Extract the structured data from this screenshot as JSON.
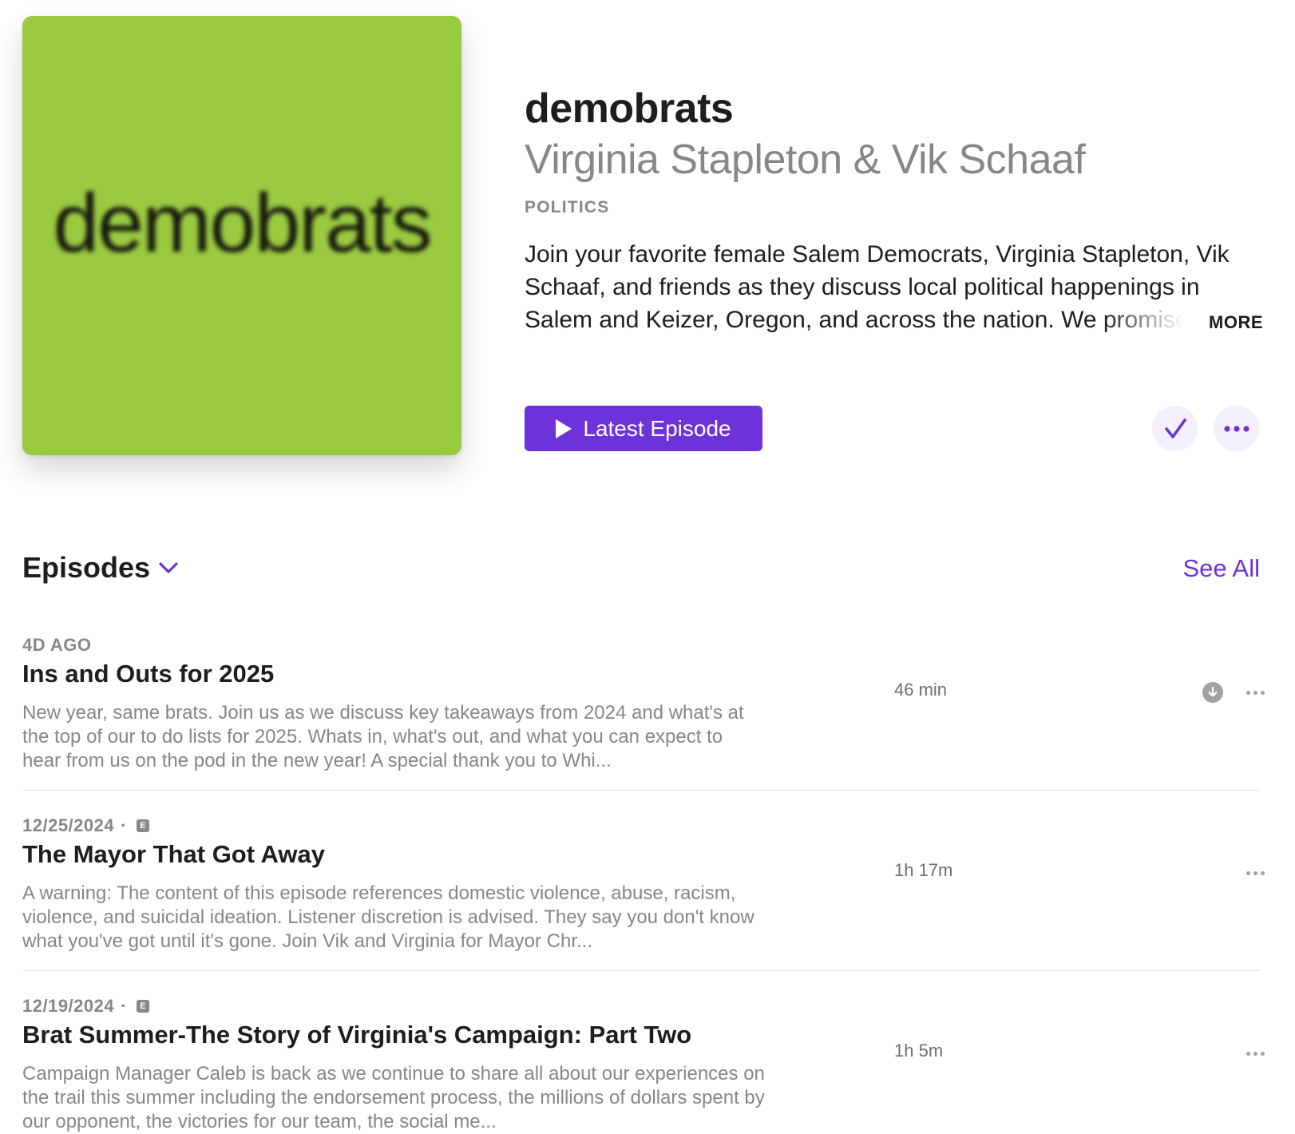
{
  "podcast": {
    "artwork_text": "demobrats",
    "title": "demobrats",
    "author": "Virginia Stapleton & Vik Schaaf",
    "category": "POLITICS",
    "description": "Join your favorite female Salem Democrats, Virginia Stapleton, Vik Schaaf, and friends as they discuss local political happenings in Salem and Keizer, Oregon, and across the nation. We promise to keep it real, and fun!",
    "more_label": "MORE",
    "latest_episode_label": "Latest Episode",
    "accent_color": "#6e32db",
    "artwork_color": "#9aca40",
    "follow_icon": "checkmark-icon",
    "more_icon": "ellipsis-icon"
  },
  "episodes": {
    "header": "Episodes",
    "see_all": "See All",
    "items": [
      {
        "date": "4D AGO",
        "explicit": false,
        "title": "Ins and Outs for 2025",
        "description": "New year, same brats. Join us as we discuss key takeaways from 2024 and what's at the top of our to do lists for 2025. Whats in, what's out, and what you can expect to hear from us on the pod in the new year! A special thank you to Whi...",
        "duration": "46 min",
        "downloadable": true
      },
      {
        "date": "12/25/2024",
        "separator": "·",
        "explicit": true,
        "explicit_label": "E",
        "title": "The Mayor That Got Away",
        "description": "A warning: The content of this episode references domestic violence, abuse, racism, violence, and suicidal ideation. Listener discretion is advised.  They say you don't know what you've got until it's gone. Join Vik and Virginia for Mayor Chr...",
        "duration": "1h 17m",
        "downloadable": false
      },
      {
        "date": "12/19/2024",
        "separator": "·",
        "explicit": true,
        "explicit_label": "E",
        "title": "Brat Summer-The Story of Virginia's Campaign: Part Two",
        "description": "Campaign Manager Caleb is back as we continue to share all about our experiences on the trail this summer including the endorsement process, the millions of dollars spent by our opponent, the victories for our team, the social me...",
        "duration": "1h 5m",
        "downloadable": false
      }
    ]
  }
}
